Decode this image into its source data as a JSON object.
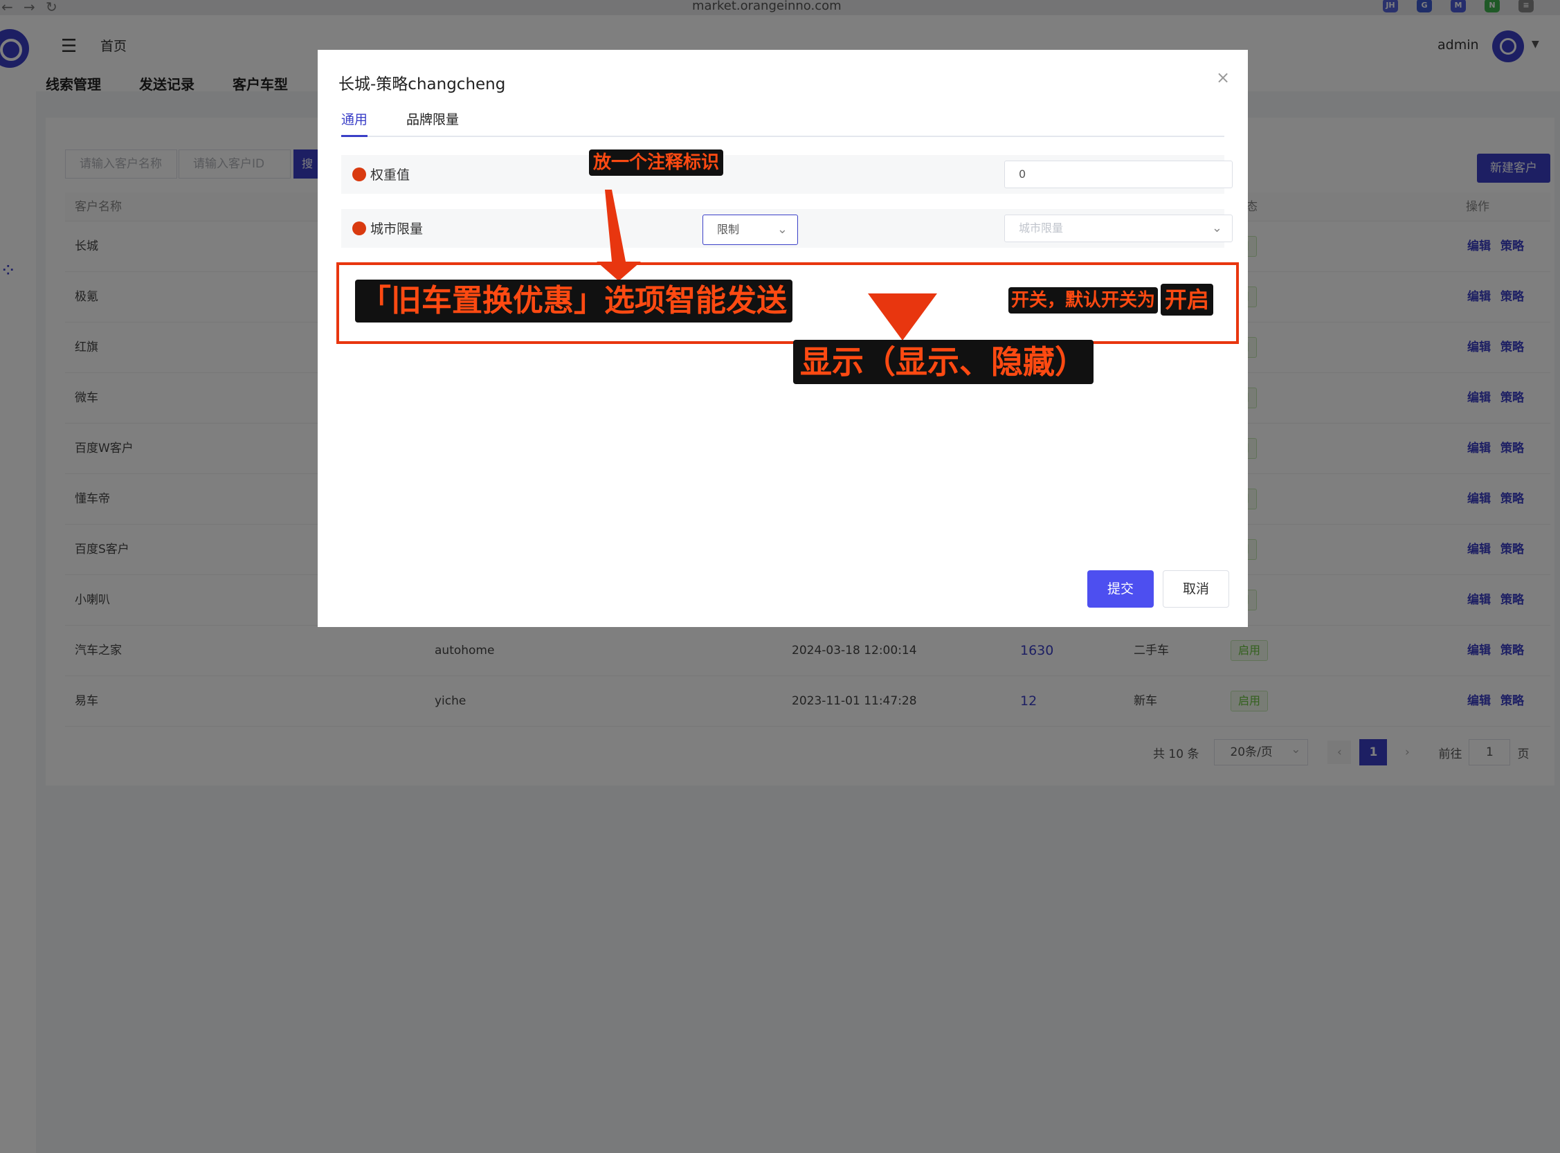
{
  "browser": {
    "url": "market.orangeinno.com",
    "back_icon": "←",
    "forward_icon": "→",
    "reload_icon": "↻",
    "extensions": [
      {
        "label": "JH",
        "color": "#5563d9"
      },
      {
        "label": "G",
        "color": "#3d5bd0"
      },
      {
        "label": "M",
        "color": "#4a5bd8"
      },
      {
        "label": "N",
        "color": "#3fb34f"
      },
      {
        "label": "≡",
        "color": "#888888"
      }
    ]
  },
  "header": {
    "breadcrumb": "首页",
    "nav": [
      "线索管理",
      "发送记录",
      "客户车型"
    ],
    "username": "admin"
  },
  "search": {
    "name_placeholder": "请输入客户名称",
    "id_placeholder": "请输入客户ID",
    "search_button": "搜"
  },
  "new_button": "新建客户",
  "table": {
    "headers": {
      "name": "客户名称",
      "op": "操作",
      "col_status": "态"
    },
    "rows": [
      {
        "name": "长城",
        "code": "",
        "time": "",
        "count": "",
        "type": "",
        "status": "用"
      },
      {
        "name": "极氪",
        "code": "",
        "time": "",
        "count": "",
        "type": "",
        "status": "用"
      },
      {
        "name": "红旗",
        "code": "",
        "time": "",
        "count": "",
        "type": "",
        "status": "用"
      },
      {
        "name": "微车",
        "code": "",
        "time": "",
        "count": "",
        "type": "",
        "status": "用"
      },
      {
        "name": "百度W客户",
        "code": "",
        "time": "",
        "count": "",
        "type": "",
        "status": "用"
      },
      {
        "name": "懂车帝",
        "code": "",
        "time": "",
        "count": "",
        "type": "",
        "status": "用"
      },
      {
        "name": "百度S客户",
        "code": "",
        "time": "",
        "count": "",
        "type": "",
        "status": "用"
      },
      {
        "name": "小喇叭",
        "code": "",
        "time": "",
        "count": "",
        "type": "",
        "status": "用"
      },
      {
        "name": "汽车之家",
        "code": "autohome",
        "time": "2024-03-18 12:00:14",
        "count": "1630",
        "type": "二手车",
        "status": "启用"
      },
      {
        "name": "易车",
        "code": "yiche",
        "time": "2023-11-01 11:47:28",
        "count": "12",
        "type": "新车",
        "status": "启用"
      }
    ],
    "op_edit": "编辑",
    "op_strategy": "策略"
  },
  "pagination": {
    "total": "共 10 条",
    "page_size": "20条/页",
    "prev": "‹",
    "next": "›",
    "current": "1",
    "goto_label": "前往",
    "goto_value": "1",
    "page_suffix": "页"
  },
  "modal": {
    "title": "长城-策略changcheng",
    "close_icon": "×",
    "tabs": [
      "通用",
      "品牌限量"
    ],
    "weight_label": "权重值",
    "weight_value": "0",
    "city_label": "城市限量",
    "city_select": "限制",
    "city_placeholder": "城市限量",
    "submit": "提交",
    "cancel": "取消"
  },
  "annotations": {
    "note_marker": "放一个注释标识",
    "option_label": "「旧车置换优惠」选项智能发送",
    "switch_note": "开关，默认开关为",
    "switch_value": "开启",
    "display_note": "显示（显示、隐藏）",
    "color": "#e8360f"
  }
}
